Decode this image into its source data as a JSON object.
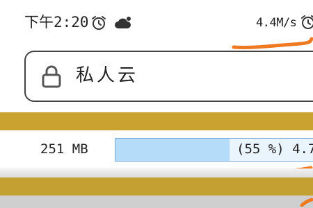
{
  "status_bar": {
    "time": "下午2:20",
    "network_speed": "4.4M/s",
    "icons": [
      "alarm-clock-icon",
      "cloud-icon",
      "alarm-clock-icon"
    ]
  },
  "title_box": {
    "icon": "lock-icon",
    "title": "私人云"
  },
  "storage": {
    "used": "251 MB",
    "percent_text": "(55 %) 4.7",
    "percent_value": 55
  },
  "colors": {
    "gold_band": "#c9a22f",
    "progress_fill": "#b5dcf8",
    "progress_border": "#7aa9d6",
    "scribble": "#f07a22"
  }
}
